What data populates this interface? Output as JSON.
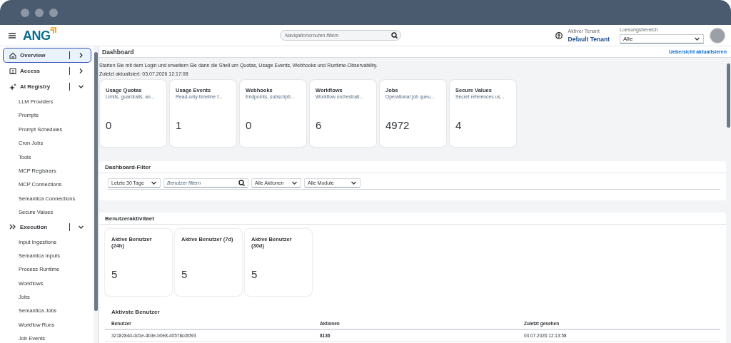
{
  "header": {
    "logo": "ANG",
    "search": {
      "placeholder": "Navigationsrouten filtern"
    },
    "tenant": {
      "label": "Aktiver Tenant",
      "value": "Default Tenant"
    },
    "scope": {
      "label": "Loesungsbereich",
      "value": "Alle"
    }
  },
  "sidebar": {
    "items": [
      {
        "kind": "group",
        "label": "Overview",
        "selected": true,
        "expanded": false
      },
      {
        "kind": "group",
        "label": "Access",
        "selected": false,
        "expanded": false
      },
      {
        "kind": "group",
        "label": "AI Registry",
        "selected": false,
        "expanded": true,
        "children": [
          {
            "label": "LLM Providers",
            "selected": false
          },
          {
            "label": "Prompts",
            "selected": false
          },
          {
            "label": "Prompt Schedules",
            "selected": false
          },
          {
            "label": "Cron Jobs",
            "selected": false
          },
          {
            "label": "Tools",
            "selected": false
          },
          {
            "label": "MCP Registrars",
            "selected": false
          },
          {
            "label": "MCP Connections",
            "selected": false
          },
          {
            "label": "Semantica Connections",
            "selected": false
          },
          {
            "label": "Secure Values",
            "selected": false
          }
        ]
      },
      {
        "kind": "group",
        "label": "Execution",
        "selected": false,
        "expanded": true,
        "children": [
          {
            "label": "Input Ingestions",
            "selected": false
          },
          {
            "label": "Semantica Inputs",
            "selected": false
          },
          {
            "label": "Process Runtime",
            "selected": false
          },
          {
            "label": "Workflows",
            "selected": false
          },
          {
            "label": "Jobs",
            "selected": false
          },
          {
            "label": "Semantica Jobs",
            "selected": false
          },
          {
            "label": "Workflow Runs",
            "selected": false
          },
          {
            "label": "Job Events",
            "selected": false
          }
        ]
      }
    ]
  },
  "page": {
    "title": "Dashboard",
    "refresh_link": "Uebersicht aktualisieren",
    "description": "Starten Sie mit dem Login und erweitern Sie dann die Shell um Quotas, Usage Events, Webhooks und Runtime-Observability.",
    "updated": "Zuletzt aktualisiert: 03.07.2026 12:17:08",
    "cards": [
      {
        "title": "Usage Quotas",
        "subtitle": "Limits, guardrails, an...",
        "value": "0"
      },
      {
        "title": "Usage Events",
        "subtitle": "Read-only timeline f...",
        "value": "1"
      },
      {
        "title": "Webhooks",
        "subtitle": "Endpoints, subscripti...",
        "value": "0"
      },
      {
        "title": "Workflows",
        "subtitle": "Workflow orchestrati...",
        "value": "6"
      },
      {
        "title": "Jobs",
        "subtitle": "Operational job queu...",
        "value": "4972"
      },
      {
        "title": "Secure Values",
        "subtitle": "Secret references us...",
        "value": "4"
      }
    ]
  },
  "filter_panel": {
    "title": "Dashboard-Filter",
    "controls": [
      {
        "kind": "select",
        "value": "Letzte 30 Tage"
      },
      {
        "kind": "search",
        "placeholder": "Benutzer filtern"
      },
      {
        "kind": "select",
        "value": "Alle Aktionen"
      },
      {
        "kind": "select",
        "value": "Alle Module"
      }
    ]
  },
  "activity_panel": {
    "title": "Benutzeraktivitaet",
    "cards": [
      {
        "title": "Aktive Benutzer (24h)",
        "value": "5"
      },
      {
        "title": "Aktive Benutzer (7d)",
        "value": "5"
      },
      {
        "title": "Aktive Benutzer (30d)",
        "value": "5"
      }
    ],
    "table": {
      "title": "Aktivste Benutzer",
      "columns": [
        "Benutzer",
        "Aktionen",
        "Zuletzt gesehen"
      ],
      "rows": [
        [
          "3218284d-dd1e-4b3e-b0e8-40578cdfd93",
          "8136",
          "03.07.2026 12:13:58"
        ]
      ]
    }
  }
}
